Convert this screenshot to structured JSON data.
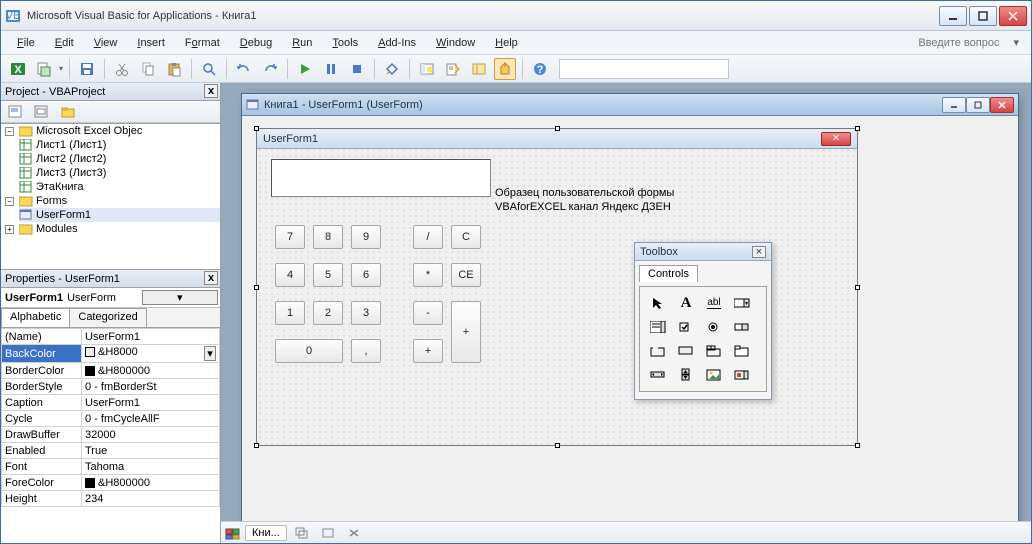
{
  "title": "Microsoft Visual Basic for Applications - Книга1",
  "menu": {
    "file": "File",
    "edit": "Edit",
    "view": "View",
    "insert": "Insert",
    "format": "Format",
    "debug": "Debug",
    "run": "Run",
    "tools": "Tools",
    "addins": "Add-Ins",
    "window": "Window",
    "help": "Help",
    "ask_placeholder": "Введите вопрос"
  },
  "project_pane": {
    "title": "Project - VBAProject",
    "nodes": {
      "excel_objects": "Microsoft Excel Objeс",
      "sheet1": "Лист1 (Лист1)",
      "sheet2": "Лист2 (Лист2)",
      "sheet3": "Лист3 (Лист3)",
      "thisworkbook": "ЭтаКнига",
      "forms": "Forms",
      "userform1": "UserForm1",
      "modules": "Modules"
    }
  },
  "props_pane": {
    "title": "Properties - UserForm1",
    "object_name": "UserForm1",
    "object_type": "UserForm",
    "tab_alpha": "Alphabetic",
    "tab_cat": "Categorized",
    "rows": [
      {
        "k": "(Name)",
        "v": "UserForm1"
      },
      {
        "k": "BackColor",
        "v": "&H8000",
        "swatch": "#f0f0f0",
        "sel": true,
        "dd": true
      },
      {
        "k": "BorderColor",
        "v": "&H800000",
        "swatch": "#000000"
      },
      {
        "k": "BorderStyle",
        "v": "0 - fmBorderSt"
      },
      {
        "k": "Caption",
        "v": "UserForm1"
      },
      {
        "k": "Cycle",
        "v": "0 - fmCycleAllF"
      },
      {
        "k": "DrawBuffer",
        "v": "32000"
      },
      {
        "k": "Enabled",
        "v": "True"
      },
      {
        "k": "Font",
        "v": "Tahoma"
      },
      {
        "k": "ForeColor",
        "v": "&H800000",
        "swatch": "#000000"
      },
      {
        "k": "Height",
        "v": "234"
      }
    ]
  },
  "child": {
    "title": "Книга1 - UserForm1 (UserForm)"
  },
  "userform": {
    "caption": "UserForm1",
    "label1": "Образец пользовательской формы",
    "label2": "VBAforEXCEL канал Яндекс ДЗЕН",
    "buttons": {
      "b7": "7",
      "b8": "8",
      "b9": "9",
      "bd": "/",
      "bc": "C",
      "b4": "4",
      "b5": "5",
      "b6": "6",
      "bm": "*",
      "bce": "CE",
      "b1": "1",
      "b2": "2",
      "b3": "3",
      "bmin": "-",
      "bp": "+",
      "b0": "0",
      "bcom": ",",
      "bpl": "+"
    }
  },
  "toolbox": {
    "title": "Toolbox",
    "tab": "Controls"
  },
  "status": {
    "doc": "Кни..."
  }
}
